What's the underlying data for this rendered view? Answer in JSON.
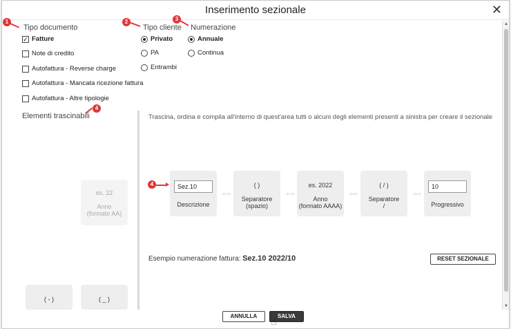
{
  "dialog": {
    "title": "Inserimento sezionale"
  },
  "tipo_documento": {
    "label": "Tipo documento",
    "options": [
      {
        "label": "Fatture",
        "checked": true
      },
      {
        "label": "Note di credito",
        "checked": false
      },
      {
        "label": "Autofattura - Reverse charge",
        "checked": false
      },
      {
        "label": "Autofattura - Mancata ricezione fattura",
        "checked": false
      },
      {
        "label": "Autofattura - Altre tipologie",
        "checked": false
      }
    ]
  },
  "tipo_cliente": {
    "label": "Tipo cliente",
    "options": [
      {
        "label": "Privato",
        "selected": true
      },
      {
        "label": "PA",
        "selected": false
      },
      {
        "label": "Entrambi",
        "selected": false
      }
    ]
  },
  "numerazione": {
    "label": "Numerazione",
    "options": [
      {
        "label": "Annuale",
        "selected": true
      },
      {
        "label": "Continua",
        "selected": false
      }
    ]
  },
  "elementi": {
    "label": "Elementi trascinabili",
    "ghost_tile": {
      "top": "es. 22",
      "line1": "Anno",
      "line2": "(formato AA)"
    },
    "small_tiles": [
      {
        "label": "( - )"
      },
      {
        "label": "( _ )"
      }
    ]
  },
  "drop_area": {
    "instructions": "Trascina, ordina e compila all'interno di quest'area tutti o alcuni degli elementi presenti a sinistra per creare il sezionale",
    "tiles": [
      {
        "input_value": "Sez.10",
        "label1": "Descrizione",
        "label2": ""
      },
      {
        "top": "( )",
        "label1": "Separatore",
        "label2": "(spazio)"
      },
      {
        "top": "es. 2022",
        "label1": "Anno",
        "label2": "(formato AAAA)"
      },
      {
        "top": "( / )",
        "label1": "Separatore",
        "label2": "/"
      },
      {
        "input_value": "10",
        "label1": "Progressivo",
        "label2": ""
      }
    ],
    "example_label": "Esempio numerazione fattura:",
    "example_value": "Sez.10 2022/10",
    "reset_label": "RESET SEZIONALE"
  },
  "footer": {
    "cancel_label": "ANNULLA",
    "save_label": "SALVA"
  },
  "annotations": [
    "1",
    "2",
    "3",
    "4",
    "4"
  ],
  "colors": {
    "annotation": "#e03636",
    "save_button": "#3a3a3a"
  }
}
